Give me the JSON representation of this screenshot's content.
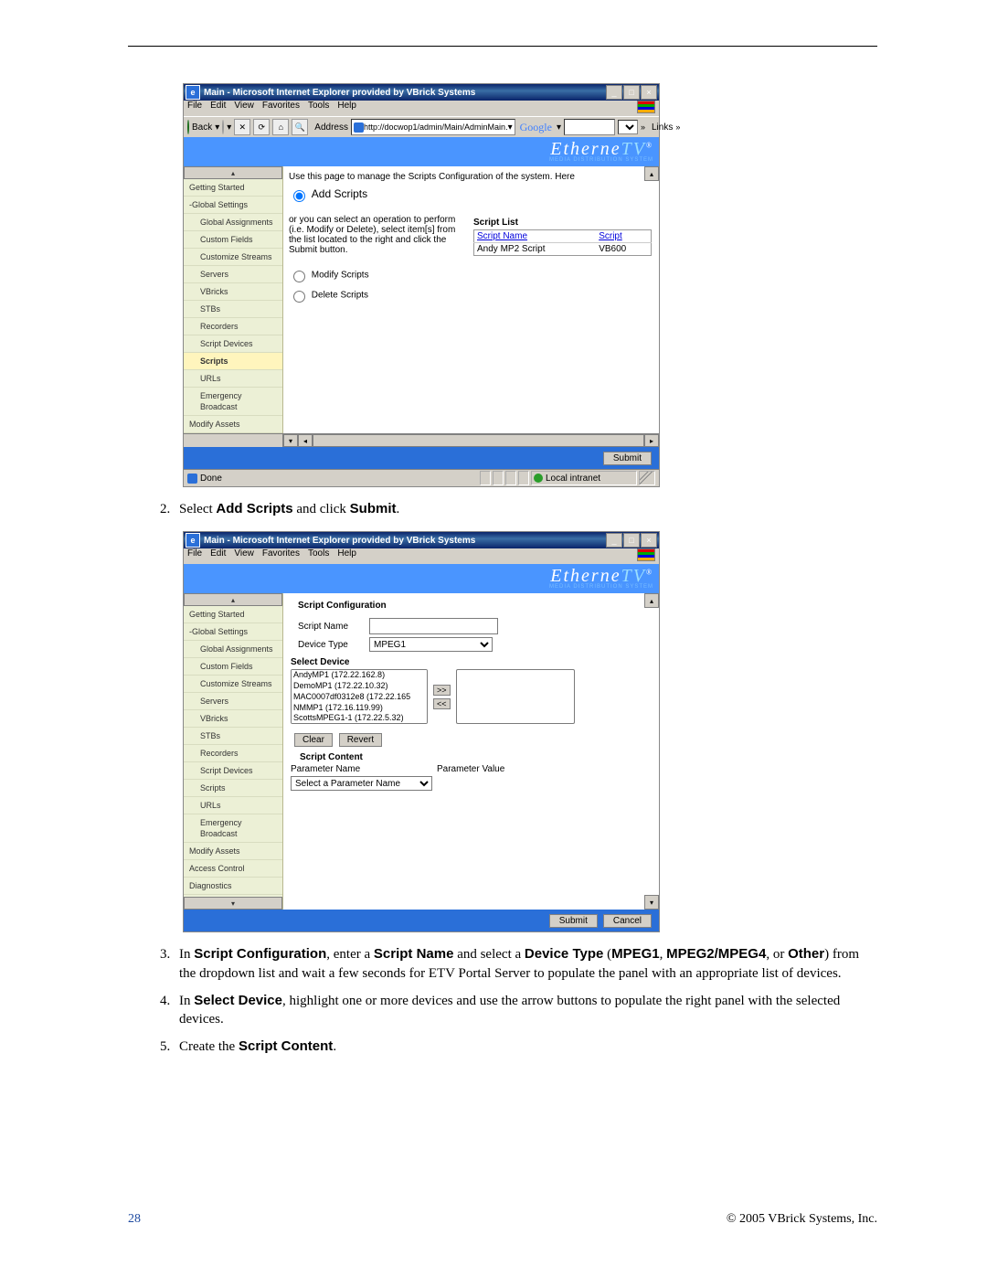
{
  "screenshot1": {
    "title": "Main - Microsoft Internet Explorer provided by VBrick Systems",
    "menus": [
      "File",
      "Edit",
      "View",
      "Favorites",
      "Tools",
      "Help"
    ],
    "back_label": "Back",
    "address_label": "Address",
    "url": "http://docwop1/admin/Main/AdminMain.",
    "google_label": "Google",
    "links_label": "Links",
    "brand_main": "Etherne",
    "brand_tv": "TV",
    "brand_sub": "MEDIA DISTRIBUTION SYSTEM",
    "sidebar": {
      "items": [
        {
          "label": "Getting Started",
          "cls": "hdr"
        },
        {
          "label": "-Global Settings",
          "cls": "hdr"
        },
        {
          "label": "Global Assignments",
          "cls": "sub"
        },
        {
          "label": "Custom Fields",
          "cls": "sub"
        },
        {
          "label": "Customize Streams",
          "cls": "sub"
        },
        {
          "label": "Servers",
          "cls": "sub"
        },
        {
          "label": "VBricks",
          "cls": "sub"
        },
        {
          "label": "STBs",
          "cls": "sub"
        },
        {
          "label": "Recorders",
          "cls": "sub"
        },
        {
          "label": "Script Devices",
          "cls": "sub"
        },
        {
          "label": "Scripts",
          "cls": "sub active"
        },
        {
          "label": "URLs",
          "cls": "sub"
        },
        {
          "label": "Emergency Broadcast",
          "cls": "sub"
        },
        {
          "label": "Modify Assets",
          "cls": "hdr"
        }
      ]
    },
    "intro": "Use this page to manage the Scripts Configuration of the system. Here",
    "add_label": "Add Scripts",
    "or_text": "or you can select an operation to perform (i.e. Modify or Delete), select item[s] from the list located to the right and click the Submit button.",
    "modify_label": "Modify Scripts",
    "delete_label": "Delete Scripts",
    "script_list_title": "Script List",
    "th_name": "Script Name",
    "th_script": "Script",
    "row_name": "Andy MP2 Script",
    "row_script": "VB600",
    "submit_label": "Submit",
    "done_label": "Done",
    "zone_label": "Local intranet"
  },
  "step2_html": "Select <b>Add Scripts</b> and click <b>Submit</b>.",
  "screenshot2": {
    "title": "Main - Microsoft Internet Explorer provided by VBrick Systems",
    "menus": [
      "File",
      "Edit",
      "View",
      "Favorites",
      "Tools",
      "Help"
    ],
    "brand_main": "Etherne",
    "brand_tv": "TV",
    "brand_sub": "MEDIA DISTRIBUTION SYSTEM",
    "sidebar": {
      "items": [
        {
          "label": "Getting Started",
          "cls": "hdr"
        },
        {
          "label": "-Global Settings",
          "cls": "hdr"
        },
        {
          "label": "Global Assignments",
          "cls": "sub"
        },
        {
          "label": "Custom Fields",
          "cls": "sub"
        },
        {
          "label": "Customize Streams",
          "cls": "sub"
        },
        {
          "label": "Servers",
          "cls": "sub"
        },
        {
          "label": "VBricks",
          "cls": "sub"
        },
        {
          "label": "STBs",
          "cls": "sub"
        },
        {
          "label": "Recorders",
          "cls": "sub"
        },
        {
          "label": "Script Devices",
          "cls": "sub"
        },
        {
          "label": "Scripts",
          "cls": "sub"
        },
        {
          "label": "URLs",
          "cls": "sub"
        },
        {
          "label": "Emergency Broadcast",
          "cls": "sub"
        },
        {
          "label": "Modify Assets",
          "cls": "hdr"
        },
        {
          "label": "Access Control",
          "cls": "hdr"
        },
        {
          "label": "Diagnostics",
          "cls": "hdr"
        }
      ]
    },
    "cfg_header": "Script Configuration",
    "script_name_label": "Script Name",
    "device_type_label": "Device Type",
    "device_type_value": "MPEG1",
    "select_device_header": "Select Device",
    "devices": [
      "AndyMP1 (172.22.162.8)",
      "DemoMP1 (172.22.10.32)",
      "MAC0007df0312e8 (172.22.165",
      "NMMP1 (172.16.119.99)",
      "ScottsMPEG1-1 (172.22.5.32)"
    ],
    "move_right": ">>",
    "move_left": "<<",
    "clear_label": "Clear",
    "revert_label": "Revert",
    "script_content_header": "Script Content",
    "param_name_label": "Parameter Name",
    "param_value_label": "Parameter Value",
    "param_select_label": "Select a Parameter Name",
    "submit_label": "Submit",
    "cancel_label": "Cancel"
  },
  "step3_html": "In <b>Script Configuration</b>, enter a <b>Script Name</b> and select a <b>Device Type</b> (<b>MPEG1</b>, <b>MPEG2/MPEG4</b>, or <b>Other</b>) from the dropdown list and wait a few seconds for ETV Portal Server to populate the panel with an appropriate list of devices.",
  "step4_html": "In <b>Select Device</b>, highlight one or more devices and use the arrow buttons to populate the right panel with the selected devices.",
  "step5_html": "Create the <b>Script Content</b>.",
  "footer_page": "28",
  "footer_copy": "© 2005 VBrick Systems, Inc."
}
